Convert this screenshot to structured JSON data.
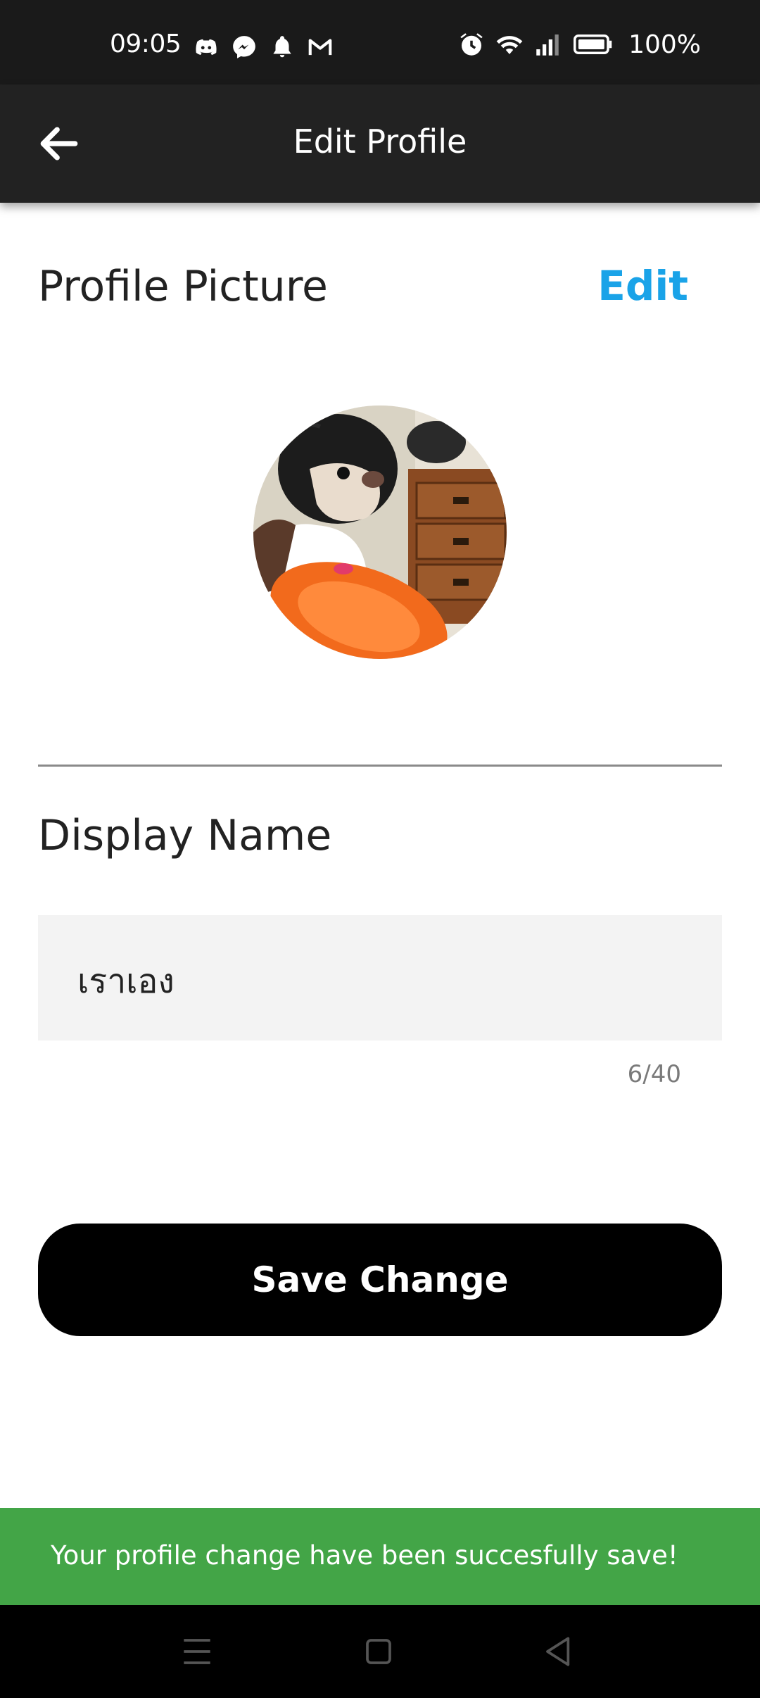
{
  "status_bar": {
    "time": "09:05",
    "battery_percent": "100%",
    "left_icons": [
      "discord-icon",
      "messenger-icon",
      "notification-app-icon",
      "gmail-icon"
    ],
    "right_icons": [
      "alarm-icon",
      "wifi-icon",
      "signal-icon",
      "battery-icon"
    ],
    "background": "#1a1a1a"
  },
  "app_bar": {
    "title": "Edit Profile",
    "back_icon": "arrow-left-icon",
    "background": "#222222"
  },
  "profile_picture": {
    "label": "Profile Picture",
    "edit_label": "Edit",
    "edit_color": "#1aa3e8",
    "avatar": "dog-photo"
  },
  "display_name": {
    "label": "Display Name",
    "value": "เราเอง",
    "char_count": "6/40"
  },
  "save_button": {
    "label": "Save Change"
  },
  "snackbar": {
    "message": "Your profile change have been succesfully save!",
    "color": "#43a547"
  },
  "nav_bar": {
    "buttons": [
      "menu-icon",
      "home-icon",
      "back-triangle-icon"
    ]
  }
}
